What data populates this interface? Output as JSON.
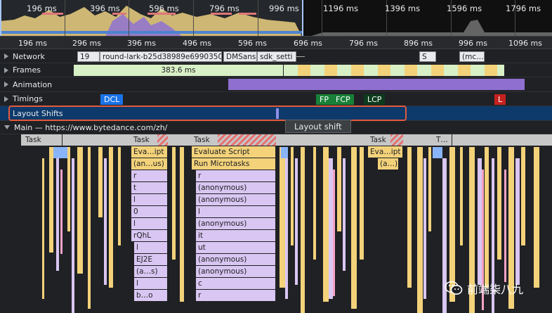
{
  "overview": {
    "ticks": [
      "196 ms",
      "396 ms",
      "596 ms",
      "796 ms",
      "996 ms",
      "1196 ms",
      "1396 ms",
      "1596 ms",
      "1796 ms"
    ]
  },
  "ruler": {
    "ticks": [
      "196 ms",
      "296 ms",
      "396 ms",
      "496 ms",
      "596 ms",
      "696 ms",
      "796 ms",
      "896 ms",
      "996 ms",
      "1096 ms"
    ]
  },
  "tracks": {
    "network": {
      "label": "Network",
      "requests": [
        "19",
        "round-lark-b25d38989e69903503",
        "DMSans",
        "sdk_setti",
        "S",
        "(mc…"
      ]
    },
    "frames": {
      "label": "Frames",
      "duration": "383.6 ms"
    },
    "animation": {
      "label": "Animation"
    },
    "timings": {
      "label": "Timings",
      "markers": [
        {
          "text": "DCL",
          "color": "#1a73e8"
        },
        {
          "text": "FP",
          "color": "#188038"
        },
        {
          "text": "FCP",
          "color": "#188038"
        },
        {
          "text": "LCP",
          "color": "#0d3b1d"
        },
        {
          "text": "L",
          "color": "#c5221f"
        }
      ]
    },
    "layout_shifts": {
      "label": "Layout Shifts",
      "tooltip": "Layout shift"
    },
    "main": {
      "label": "Main — https://www.bytedance.com/zh/"
    }
  },
  "flame": {
    "task": "Task",
    "task_t": "T…",
    "col1": [
      "Eva…ipt",
      "(an…us)",
      "r",
      "t",
      "l",
      "0",
      "l",
      "rQhL",
      "l",
      "EJ2E",
      "(a…s)",
      "l",
      "b…o"
    ],
    "col2": [
      "Evaluate Script",
      "Run Microtasks",
      "r",
      "(anonymous)",
      "(anonymous)",
      "l",
      "(anonymous)",
      "it",
      "ut",
      "(anonymous)",
      "(anonymous)",
      "c",
      "r"
    ],
    "col3": [
      "Eva…ipt",
      "(a…)"
    ]
  },
  "colors": {
    "scripting": "#f3d27a",
    "microtask": "#d9c6f2",
    "system": "#c7c7c7",
    "frame": "#d8f0c6",
    "animation": "#8f6fd0",
    "layout_shift_track": "#0e3a6b",
    "highlight": "#e25a3d"
  },
  "watermark": {
    "text": "前端柒八九"
  }
}
